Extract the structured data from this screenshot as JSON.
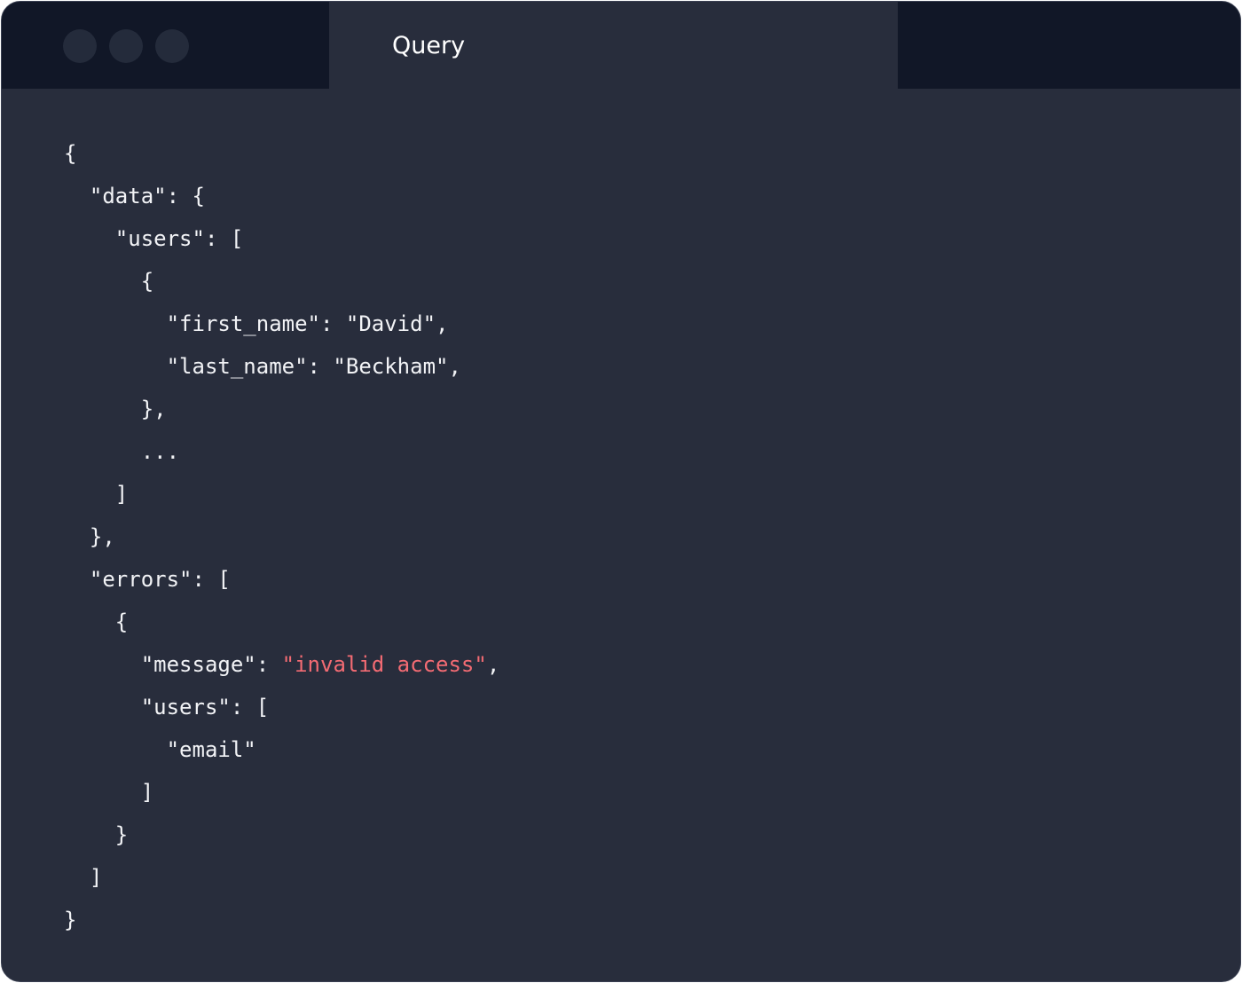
{
  "window": {
    "tab_title": "Query"
  },
  "code": {
    "lines": [
      [
        {
          "text": "{"
        }
      ],
      [
        {
          "text": "  \"data\": {"
        }
      ],
      [
        {
          "text": "    \"users\": ["
        }
      ],
      [
        {
          "text": "      {"
        }
      ],
      [
        {
          "text": "        \"first_name\": \"David\","
        }
      ],
      [
        {
          "text": "        \"last_name\": \"Beckham\","
        }
      ],
      [
        {
          "text": "      },"
        }
      ],
      [
        {
          "text": "      ..."
        }
      ],
      [
        {
          "text": "    ]"
        }
      ],
      [
        {
          "text": "  },"
        }
      ],
      [
        {
          "text": "  \"errors\": ["
        }
      ],
      [
        {
          "text": "    {"
        }
      ],
      [
        {
          "text": "      \"message\": "
        },
        {
          "text": "\"invalid access\"",
          "class": "err"
        },
        {
          "text": ","
        }
      ],
      [
        {
          "text": "      \"users\": ["
        }
      ],
      [
        {
          "text": "        \"email\""
        }
      ],
      [
        {
          "text": "      ]"
        }
      ],
      [
        {
          "text": "    }"
        }
      ],
      [
        {
          "text": "  ]"
        }
      ],
      [
        {
          "text": "}"
        }
      ]
    ]
  },
  "colors": {
    "background": "#282d3c",
    "titlebar": "#111727",
    "text": "#f2f3f6",
    "error_string": "#f36b73"
  }
}
